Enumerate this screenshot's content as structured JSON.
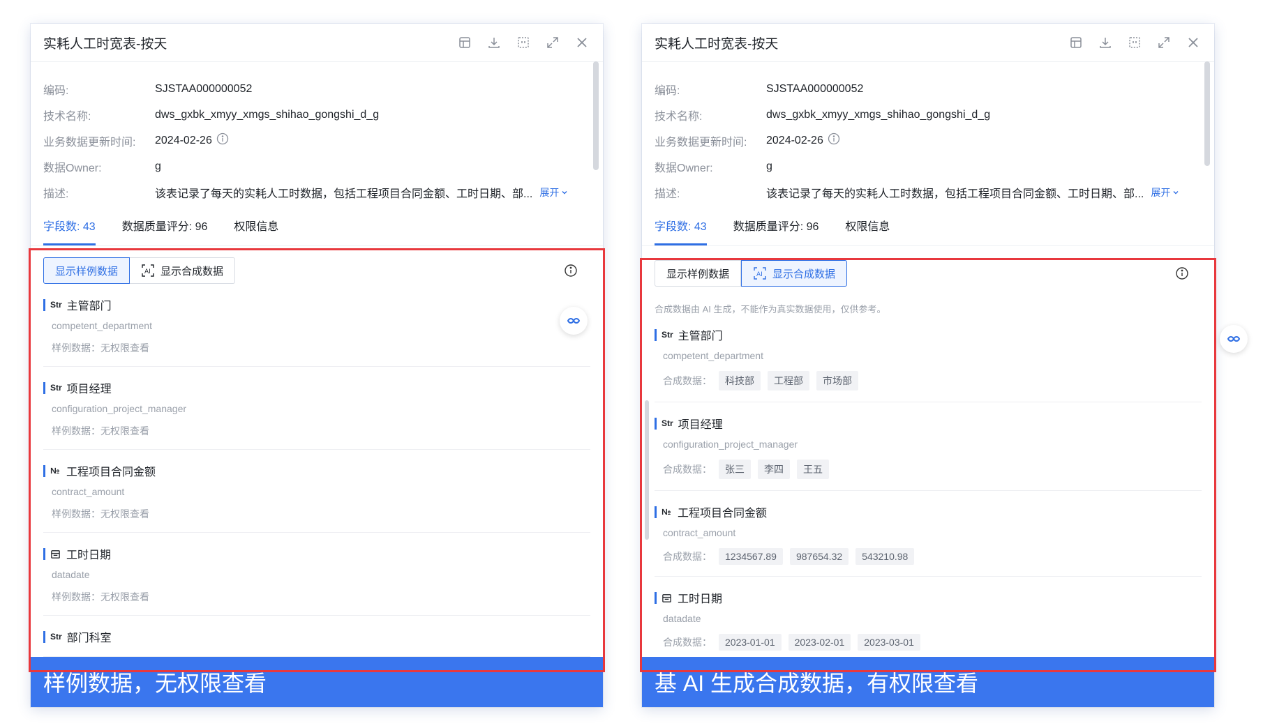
{
  "title": "实耗人工时宽表-按天",
  "meta": {
    "code_label": "编码:",
    "code_value": "SJSTAA000000052",
    "tech_label": "技术名称:",
    "tech_value": "dws_gxbk_xmyy_xmgs_shihao_gongshi_d_g",
    "update_label": "业务数据更新时间:",
    "update_value": "2024-02-26",
    "owner_label": "数据Owner:",
    "owner_value": "g",
    "desc_label": "描述:",
    "desc_value": "该表记录了每天的实耗人工时数据，包括工程项目合同金额、工时日期、部...",
    "expand_label": "展开"
  },
  "tabs": {
    "fields": "字段数: 43",
    "quality": "数据质量评分: 96",
    "permission": "权限信息"
  },
  "toggle": {
    "sample": "显示样例数据",
    "synthetic": "显示合成数据"
  },
  "ai_note": "合成数据由 AI 生成，不能作为真实数据使用，仅供参考。",
  "left": {
    "banner": "样例数据，无权限查看",
    "fields": [
      {
        "type": "Str",
        "name": "主管部门",
        "tech": "competent_department",
        "sample": "样例数据：无权限查看"
      },
      {
        "type": "Str",
        "name": "项目经理",
        "tech": "configuration_project_manager",
        "sample": "样例数据：无权限查看"
      },
      {
        "type": "№",
        "name": "工程项目合同金额",
        "tech": "contract_amount",
        "sample": "样例数据：无权限查看"
      },
      {
        "type": "date",
        "name": "工时日期",
        "tech": "datadate",
        "sample": "样例数据：无权限查看"
      },
      {
        "type": "Str",
        "name": "部门科室",
        "tech": "",
        "sample": ""
      }
    ]
  },
  "right": {
    "banner": "基 AI 生成合成数据，有权限查看",
    "sample_label": "合成数据：",
    "fields": [
      {
        "type": "Str",
        "name": "主管部门",
        "tech": "competent_department",
        "chips": [
          "科技部",
          "工程部",
          "市场部"
        ]
      },
      {
        "type": "Str",
        "name": "项目经理",
        "tech": "configuration_project_manager",
        "chips": [
          "张三",
          "李四",
          "王五"
        ]
      },
      {
        "type": "№",
        "name": "工程项目合同金额",
        "tech": "contract_amount",
        "chips": [
          "1234567.89",
          "987654.32",
          "543210.98"
        ]
      },
      {
        "type": "date",
        "name": "工时日期",
        "tech": "datadate",
        "chips": [
          "2023-01-01",
          "2023-02-01",
          "2023-03-01"
        ]
      }
    ]
  },
  "colors": {
    "accent": "#2f6fe4",
    "frame": "#e8383d",
    "banner": "#3a76ee"
  }
}
